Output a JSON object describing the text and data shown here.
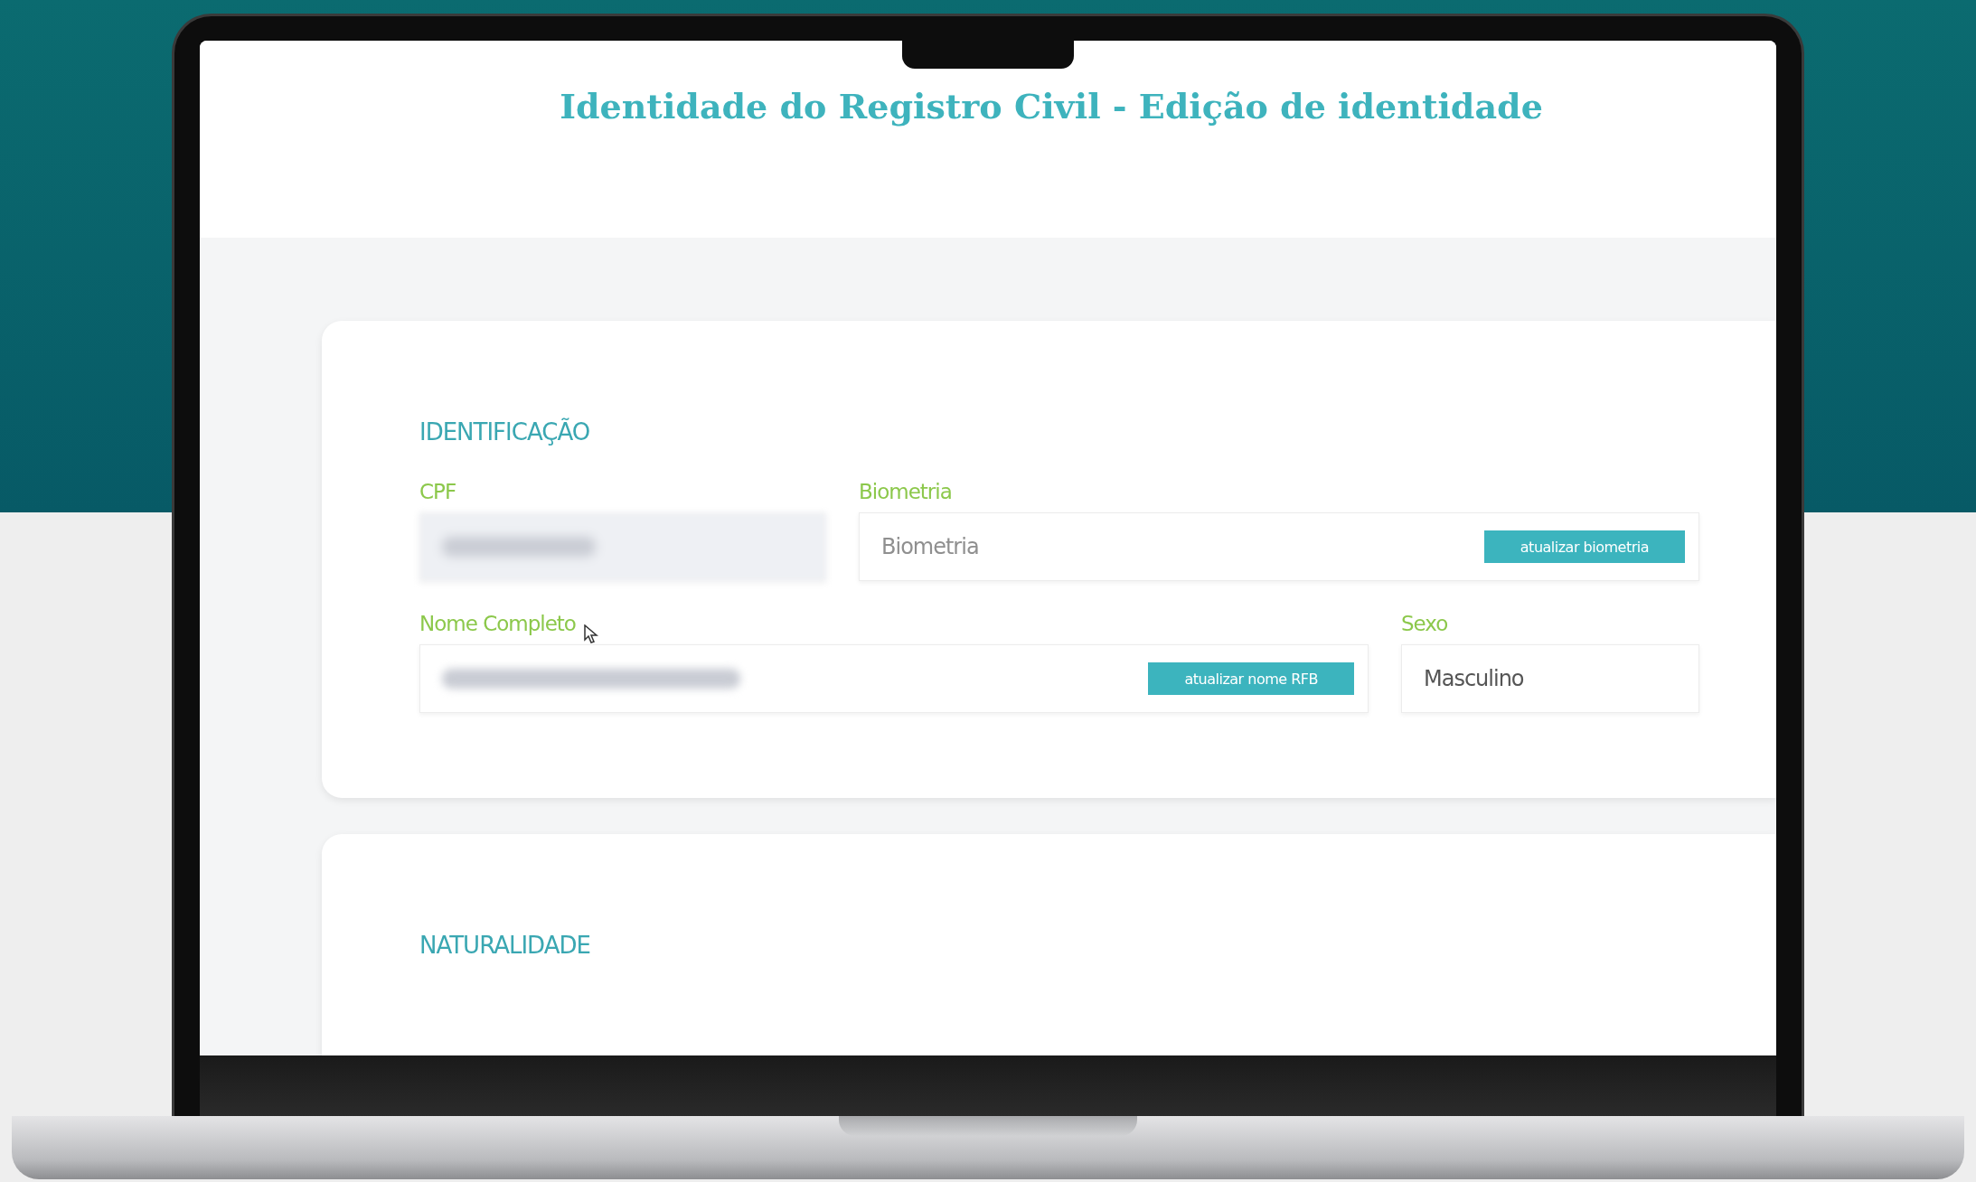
{
  "page": {
    "title": "Identidade do Registro Civil - Edição de identidade"
  },
  "sections": [
    {
      "heading": "IDENTIFICAÇÃO",
      "rows": [
        {
          "fields": [
            {
              "kind": "blurred",
              "label": "CPF"
            },
            {
              "kind": "placeholder-button",
              "label": "Biometria",
              "placeholder": "Biometria",
              "button": "atualizar biometria"
            }
          ]
        },
        {
          "fields": [
            {
              "kind": "blurred-button",
              "label": "Nome Completo",
              "button": "atualizar nome RFB",
              "cursor": true
            },
            {
              "kind": "value",
              "label": "Sexo",
              "value": "Masculino"
            }
          ]
        }
      ]
    },
    {
      "heading": "NATURALIDADE"
    }
  ]
}
